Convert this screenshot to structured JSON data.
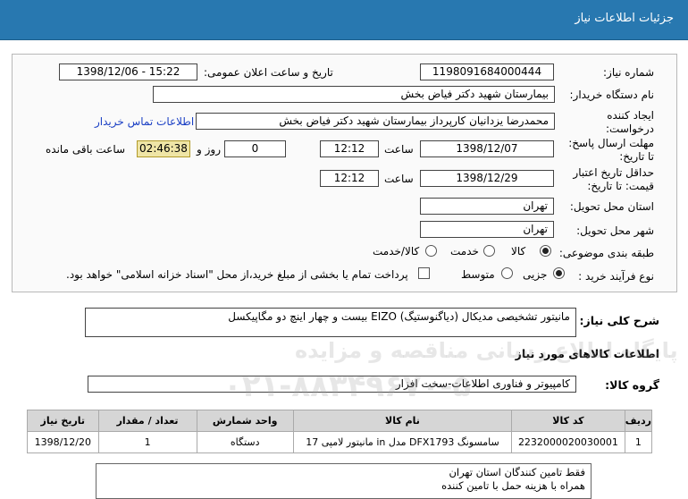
{
  "header": {
    "title": "جزئیات اطلاعات نیاز"
  },
  "fields": {
    "need_number_label": "شماره نیاز:",
    "need_number": "1198091684000444",
    "announce_label": "تاریخ و ساعت اعلان عمومی:",
    "announce_value": "1398/12/06 - 15:22",
    "buyer_label": "نام دستگاه خریدار:",
    "buyer": "بیمارستان شهید دکتر فیاض بخش",
    "creator_label": "ایجاد کننده درخواست:",
    "creator": "محمدرضا یزدانیان کارپرداز بیمارستان شهید دکتر فیاض بخش",
    "contact_link": "اطلاعات تماس خریدار",
    "deadline_label": "مهلت ارسال پاسخ: تا تاریخ:",
    "deadline_date": "1398/12/07",
    "time_label": "ساعت",
    "deadline_time": "12:12",
    "days": "0",
    "days_label": "روز و",
    "remaining": "02:46:38",
    "remaining_label": "ساعت باقی مانده",
    "validity_label": "حداقل تاریخ اعتبار قیمت: تا تاریخ:",
    "validity_date": "1398/12/29",
    "validity_time": "12:12",
    "province_label": "استان محل تحویل:",
    "province": "تهران",
    "city_label": "شهر محل تحویل:",
    "city": "تهران",
    "category_label": "طبقه بندی موضوعی:",
    "category_options": [
      "کالا",
      "خدمت",
      "کالا/خدمت"
    ],
    "process_label": "نوع فرآیند خرید :",
    "process_options": [
      "جزیی",
      "متوسط"
    ],
    "payment_note": "پرداخت تمام یا بخشی از مبلغ خرید،از محل \"اسناد خزانه اسلامی\" خواهد بود."
  },
  "summary": {
    "label": "شرح کلی نیاز:",
    "value": "مانیتور تشخیصی مدیکال (دیاگنوستیگ) EIZO بیست و چهار اینچ دو مگاپیکسل"
  },
  "goods_section": {
    "title": "اطلاعات کالاهای مورد نیاز"
  },
  "goods_group": {
    "label": "گروه کالا:",
    "value": "کامپیوتر و فناوری اطلاعات-سخت افزار"
  },
  "table": {
    "headers": [
      "ردیف",
      "کد کالا",
      "نام کالا",
      "واحد شمارش",
      "تعداد / مقدار",
      "تاریخ نیاز"
    ],
    "rows": [
      [
        "1",
        "2232000020030001",
        "مانیتور لامپی 17 in مدل DFX1793 سامسونگ",
        "دستگاه",
        "1",
        "1398/12/20"
      ]
    ]
  },
  "notes": {
    "line1": "فقط تامین کنندگان استان تهران",
    "line2": "همراه با هزینه حمل با تامین کننده"
  },
  "watermark": {
    "line1": "پایگاه اطلاع رسانی مناقصه و مزایده",
    "line2": "۰۲۱-۸۸۳۴۹۶۷۰-۵"
  }
}
